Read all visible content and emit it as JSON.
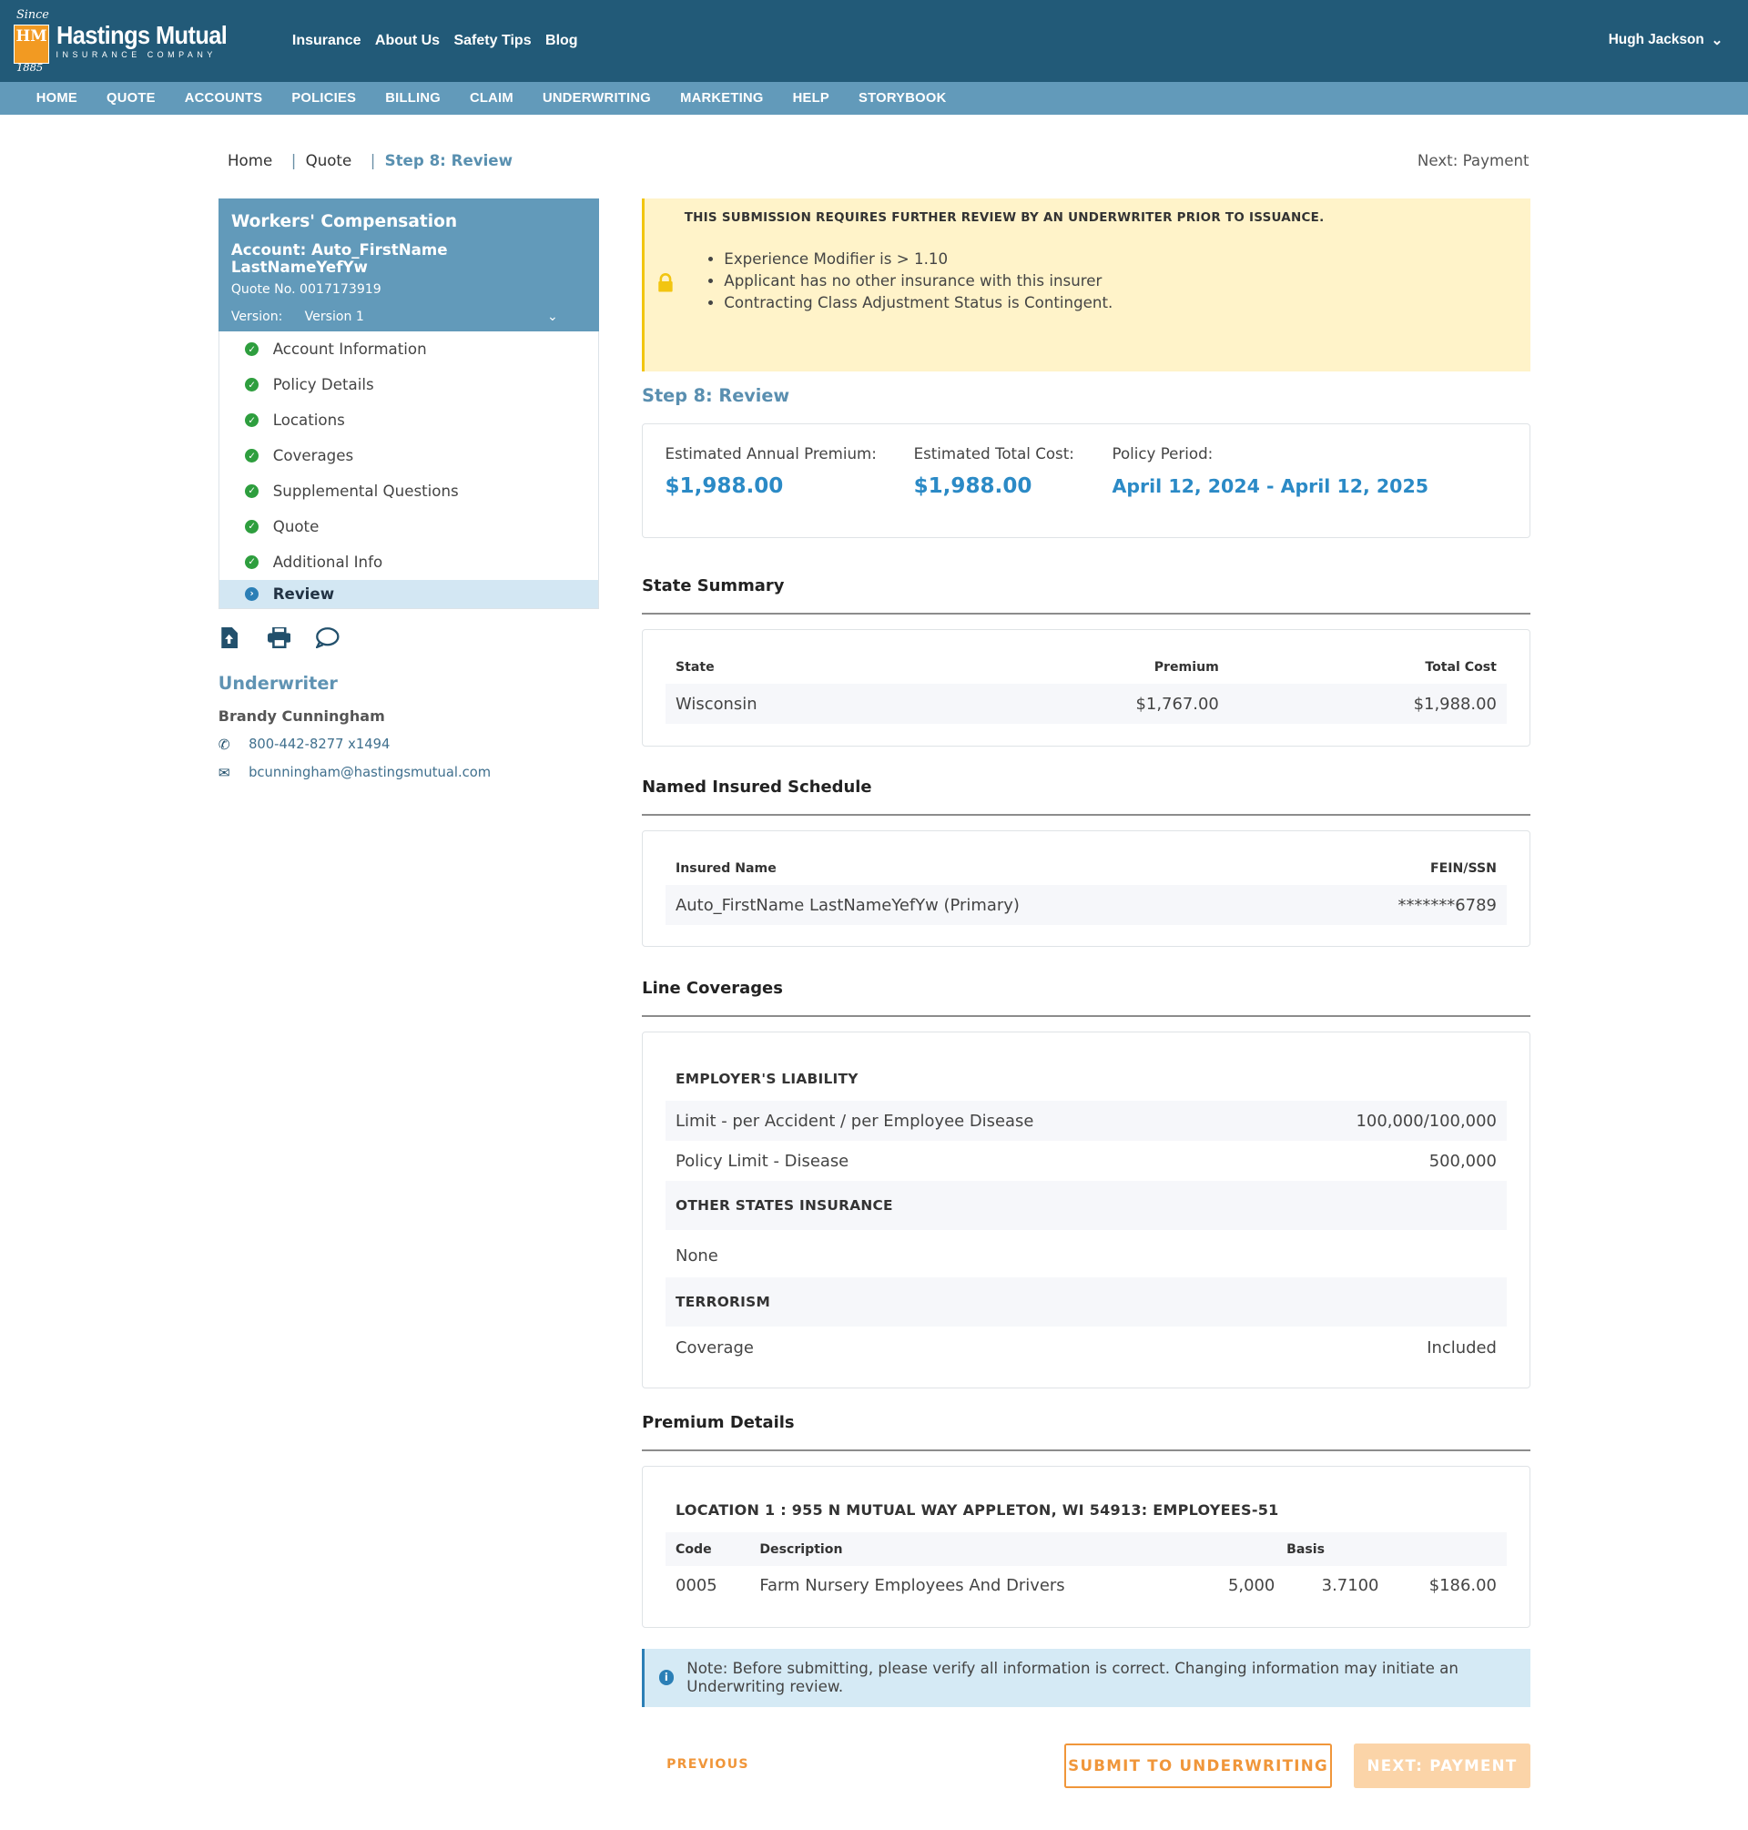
{
  "logo": {
    "since": "Since",
    "mark": "HM",
    "year": "1885",
    "name": "Hastings Mutual",
    "tagline": "INSURANCE COMPANY"
  },
  "topnav": [
    "Insurance",
    "About Us",
    "Safety Tips",
    "Blog"
  ],
  "user": {
    "name": "Hugh Jackson"
  },
  "mainnav": [
    "HOME",
    "QUOTE",
    "ACCOUNTS",
    "POLICIES",
    "BILLING",
    "CLAIM",
    "UNDERWRITING",
    "MARKETING",
    "HELP",
    "STORYBOOK"
  ],
  "breadcrumb": {
    "home": "Home",
    "quote": "Quote",
    "current": "Step 8: Review",
    "next": "Next: Payment"
  },
  "sidebar": {
    "title": "Workers' Compensation",
    "account": "Account: Auto_FirstName LastNameYefYw",
    "quote_no": "Quote No. 0017173919",
    "version_label": "Version:",
    "version_value": "Version 1",
    "steps": [
      {
        "label": "Account Information",
        "status": "done"
      },
      {
        "label": "Policy Details",
        "status": "done"
      },
      {
        "label": "Locations",
        "status": "done"
      },
      {
        "label": "Coverages",
        "status": "done"
      },
      {
        "label": "Supplemental Questions",
        "status": "done"
      },
      {
        "label": "Quote",
        "status": "done"
      },
      {
        "label": "Additional Info",
        "status": "done"
      },
      {
        "label": "Review",
        "status": "active"
      }
    ]
  },
  "underwriter": {
    "title": "Underwriter",
    "name": "Brandy Cunningham",
    "phone": "800-442-8277 x1494",
    "email": "bcunningham@hastingsmutual.com"
  },
  "alert": {
    "heading": "THIS SUBMISSION REQUIRES FURTHER REVIEW BY AN UNDERWRITER PRIOR TO ISSUANCE.",
    "items": [
      "Experience Modifier is > 1.10",
      "Applicant has no other insurance with this insurer",
      "Contracting Class Adjustment Status is Contingent."
    ]
  },
  "review": {
    "title": "Step 8: Review",
    "annual_premium_label": "Estimated Annual Premium:",
    "annual_premium": "$1,988.00",
    "total_cost_label": "Estimated Total Cost:",
    "total_cost": "$1,988.00",
    "policy_period_label": "Policy Period:",
    "policy_period": "April 12, 2024 - April 12, 2025"
  },
  "state_summary": {
    "title": "State Summary",
    "headers": [
      "State",
      "Premium",
      "Total Cost"
    ],
    "rows": [
      [
        "Wisconsin",
        "$1,767.00",
        "$1,988.00"
      ]
    ]
  },
  "named_insured": {
    "title": "Named Insured Schedule",
    "headers": [
      "Insured Name",
      "FEIN/SSN"
    ],
    "rows": [
      [
        "Auto_FirstName LastNameYefYw (Primary)",
        "*******6789"
      ]
    ]
  },
  "line_coverages": {
    "title": "Line Coverages",
    "employers_liability": "EMPLOYER'S LIABILITY",
    "el_rows": [
      [
        "Limit - per Accident / per Employee Disease",
        "100,000/100,000"
      ],
      [
        "Policy Limit - Disease",
        "500,000"
      ]
    ],
    "other_states": "OTHER STATES INSURANCE",
    "other_states_value": "None",
    "terrorism": "TERRORISM",
    "terrorism_row": [
      "Coverage",
      "Included"
    ]
  },
  "premium_details": {
    "title": "Premium Details",
    "location": "LOCATION 1 : 955 N MUTUAL WAY APPLETON, WI 54913: EMPLOYEES-51",
    "headers": [
      "Code",
      "Description",
      "Basis"
    ],
    "rows": [
      [
        "0005",
        "Farm Nursery Employees And Drivers",
        "5,000",
        "3.7100",
        "$186.00"
      ]
    ]
  },
  "note": "Note: Before submitting, please verify all information is correct. Changing information may initiate an Underwriting review.",
  "buttons": {
    "previous": "PREVIOUS",
    "submit": "SUBMIT TO UNDERWRITING",
    "next": "NEXT: PAYMENT"
  },
  "colors": {
    "header": "#225a78",
    "nav": "#629aba",
    "accent": "#2b8ac6",
    "orange": "#f0963a",
    "alert": "#fff3c9"
  }
}
